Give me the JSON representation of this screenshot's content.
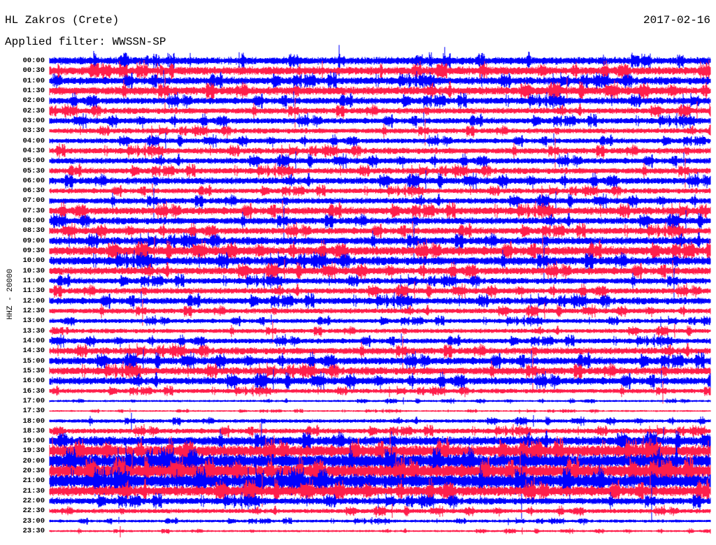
{
  "header": {
    "station": "HL Zakros (Crete)",
    "filter": "Applied filter: WWSSN-SP",
    "date": "2017-02-16"
  },
  "chart_data": {
    "type": "line",
    "title": "HL Zakros (Crete)",
    "ylabel": "HHZ - 20000",
    "colors": [
      "#0000ff",
      "#ff1e4b"
    ],
    "row_labels": [
      "00:00",
      "00:30",
      "01:00",
      "01:30",
      "02:00",
      "02:30",
      "03:00",
      "03:30",
      "04:00",
      "04:30",
      "05:00",
      "05:30",
      "06:00",
      "06:30",
      "07:00",
      "07:30",
      "08:00",
      "08:30",
      "09:00",
      "09:30",
      "10:00",
      "10:30",
      "11:00",
      "11:30",
      "12:00",
      "12:30",
      "13:00",
      "13:30",
      "14:00",
      "14:30",
      "15:00",
      "15:30",
      "16:00",
      "16:30",
      "17:00",
      "17:30",
      "18:00",
      "18:30",
      "19:00",
      "19:30",
      "20:00",
      "20:30",
      "21:00",
      "21:30",
      "22:00",
      "22:30",
      "23:00",
      "23:30"
    ],
    "relative_amplitude": [
      0.5,
      0.55,
      0.5,
      0.55,
      0.45,
      0.4,
      0.4,
      0.35,
      0.35,
      0.4,
      0.4,
      0.4,
      0.45,
      0.35,
      0.4,
      0.5,
      0.45,
      0.45,
      0.5,
      0.6,
      0.55,
      0.5,
      0.4,
      0.4,
      0.45,
      0.35,
      0.3,
      0.3,
      0.35,
      0.45,
      0.5,
      0.5,
      0.5,
      0.3,
      0.15,
      0.12,
      0.25,
      0.35,
      0.6,
      0.8,
      0.9,
      0.9,
      0.9,
      0.7,
      0.45,
      0.3,
      0.2,
      0.15
    ],
    "minutes_per_row": 30
  }
}
